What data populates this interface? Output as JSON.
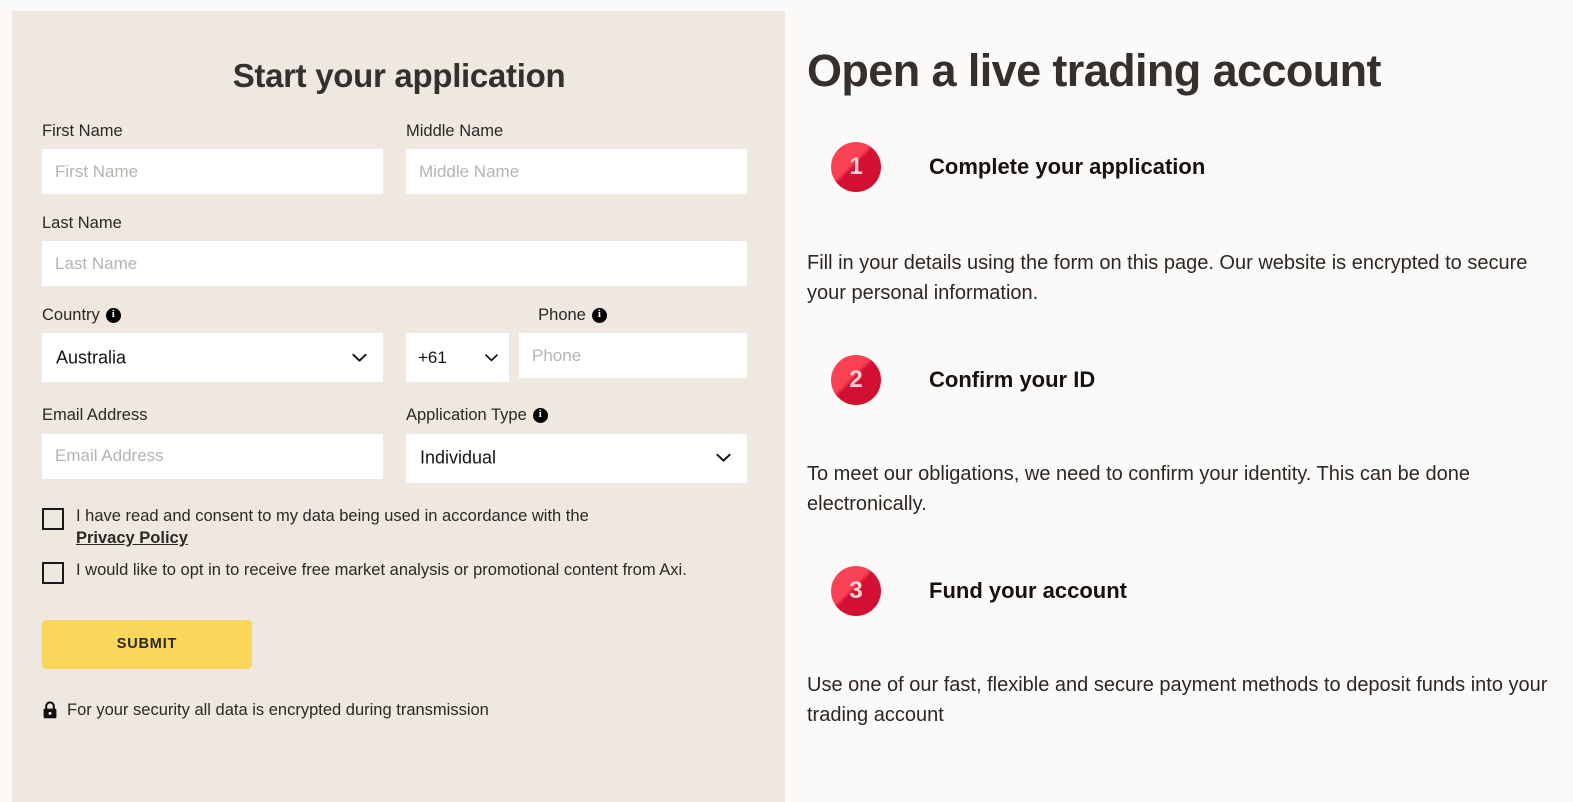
{
  "form": {
    "title": "Start your application",
    "fields": {
      "first_name": {
        "label": "First Name",
        "placeholder": "First Name",
        "value": ""
      },
      "middle_name": {
        "label": "Middle Name",
        "placeholder": "Middle Name",
        "value": ""
      },
      "last_name": {
        "label": "Last Name",
        "placeholder": "Last Name",
        "value": ""
      },
      "country": {
        "label": "Country",
        "value": "Australia",
        "has_info": true
      },
      "phone": {
        "label": "Phone",
        "code_value": "+61",
        "placeholder": "Phone",
        "value": "",
        "has_info": true
      },
      "email": {
        "label": "Email Address",
        "placeholder": "Email Address",
        "value": ""
      },
      "application_type": {
        "label": "Application Type",
        "value": "Individual",
        "has_info": true
      }
    },
    "consent": {
      "text": "I have read and consent to my data being used in accordance with the",
      "link_label": "Privacy Policy",
      "checked": false
    },
    "marketing": {
      "text": "I would like to opt in to receive free market analysis or promotional content from Axi.",
      "checked": false
    },
    "submit_label": "SUBMIT",
    "security_note": "For your security all data is encrypted during transmission"
  },
  "info": {
    "title": "Open a live trading account",
    "steps": [
      {
        "number": "1",
        "title": "Complete your application",
        "body": "Fill in your details using the form on this page. Our website is encrypted to secure your personal information."
      },
      {
        "number": "2",
        "title": "Confirm your ID",
        "body": "To meet our obligations, we need to confirm your identity. This can be done electronically."
      },
      {
        "number": "3",
        "title": "Fund your account",
        "body": "Use one of our fast, flexible and secure payment methods to deposit funds into your trading account"
      }
    ]
  },
  "icons": {
    "info": "info-icon",
    "chevron": "chevron-down-icon",
    "lock": "lock-icon"
  },
  "colors": {
    "panel_bg": "#EEE8E1",
    "page_bg": "#FBFAF8",
    "submit_yellow": "#FBD65C",
    "badge_red": "#FB4254",
    "badge_red_dark": "#CF0F31",
    "text_dark": "#2B2724",
    "heading_dark": "#33302E",
    "placeholder_grey": "#B7B3AF"
  }
}
